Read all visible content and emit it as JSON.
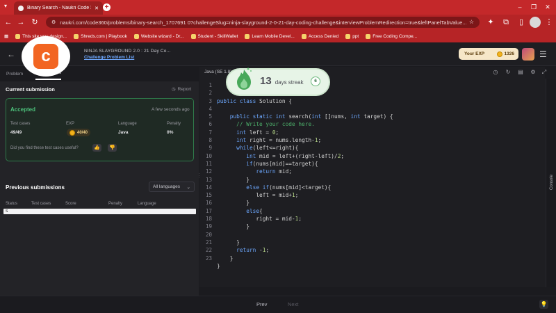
{
  "browser": {
    "tab_title": "Binary Search - Naukri Code 36",
    "url": "naukri.com/code360/problems/binary-search_1707691 0?challengeSlug=ninja-slayground-2-0-21-day-coding-challenge&interviewProblemRedirection=true&leftPanelTabValue...",
    "bookmarks": [
      "This site was design...",
      "Shreds.com | Playbook",
      "Website wizard - Dr...",
      "Student - SkillWallet",
      "Learn Mobile Devel...",
      "Access Denied",
      "ppt",
      "Free Coding Compe..."
    ]
  },
  "header": {
    "challenge_title": "NINJA SLAYGROUND 2.0 : 21 Day Co...",
    "challenge_link": "Challenge Problem List",
    "exp_label": "Your EXP",
    "exp_value": "1326"
  },
  "left": {
    "tabs": [
      "Problem",
      "Submissions"
    ],
    "current_title": "Current submission",
    "report": "Report",
    "status": "Accepted",
    "time": "A few seconds ago",
    "stats": {
      "test_cases_label": "Test cases",
      "test_cases_value": "49/49",
      "exp_label": "EXP",
      "exp_value": "40/40",
      "language_label": "Language",
      "language_value": "Java",
      "penalty_label": "Penalty",
      "penalty_value": "0%"
    },
    "useful_question": "Did you find these test cases useful?",
    "prev_title": "Previous submissions",
    "lang_filter": "All languages",
    "columns": [
      "Status",
      "Test cases",
      "Score",
      "Penalty",
      "Language"
    ],
    "row_cell": "S"
  },
  "editor": {
    "language": "Java (SE 1.8)",
    "console_label": "Console",
    "lines": [
      "1",
      "2",
      "3",
      "4",
      "5",
      "6",
      "7",
      "8",
      "9",
      "10",
      "11",
      "12",
      "13",
      "14",
      "15",
      "16",
      "17",
      "18",
      "19",
      "20",
      "21",
      "22",
      "23"
    ]
  },
  "streak": {
    "count": "13",
    "label": "days streak",
    "badge": "6"
  },
  "footer": {
    "prev": "Prev",
    "next": "Next"
  },
  "colors": {
    "accent_red": "#c4282a",
    "accepted_green": "#4cc07a",
    "link_blue": "#6ea8ff"
  }
}
